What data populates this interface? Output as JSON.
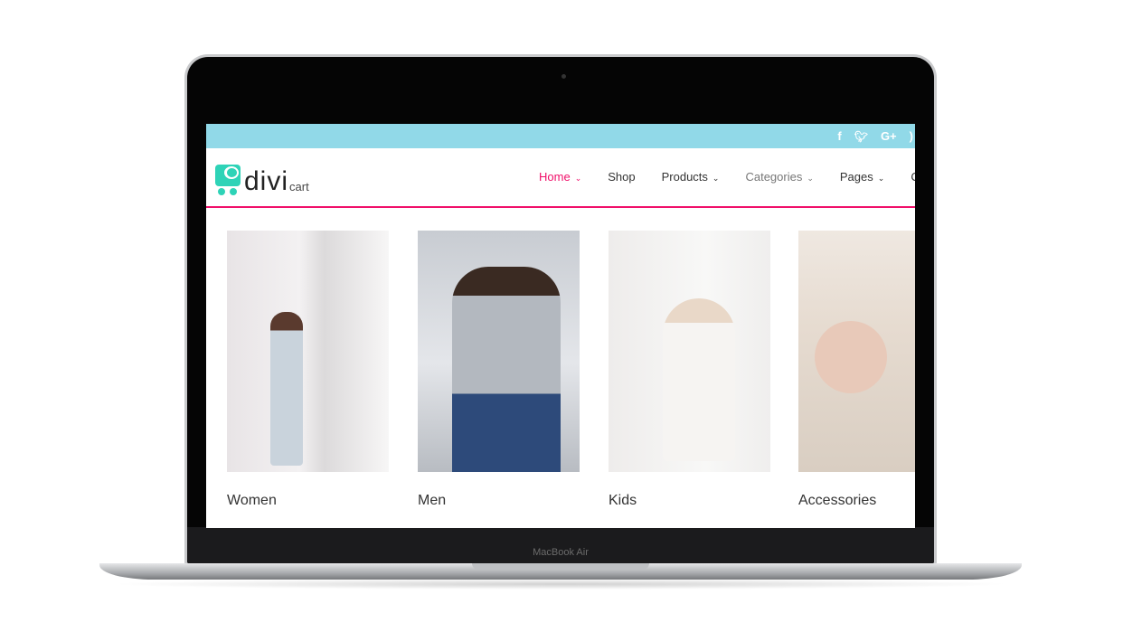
{
  "device": {
    "brand": "MacBook Air"
  },
  "topbar": {
    "social": [
      {
        "icon": "facebook-icon",
        "glyph": "f"
      },
      {
        "icon": "twitter-icon",
        "glyph": "🐦"
      },
      {
        "icon": "google-plus-icon",
        "glyph": "G+"
      },
      {
        "icon": "rss-icon",
        "glyph": "\\"
      }
    ]
  },
  "logo": {
    "main": "divi",
    "sub": "cart",
    "color": "#2ed3b7"
  },
  "nav": {
    "items": [
      {
        "label": "Home",
        "dropdown": true,
        "active": true
      },
      {
        "label": "Shop",
        "dropdown": false
      },
      {
        "label": "Products",
        "dropdown": true
      },
      {
        "label": "Categories",
        "dropdown": true
      },
      {
        "label": "Pages",
        "dropdown": true
      },
      {
        "label": "C",
        "dropdown": false
      }
    ],
    "active_color": "#f0106a"
  },
  "categories": [
    {
      "label": "Women"
    },
    {
      "label": "Men"
    },
    {
      "label": "Kids"
    },
    {
      "label": "Accessories"
    }
  ],
  "colors": {
    "topbar": "#91d9e8",
    "accent": "#f0106a"
  }
}
